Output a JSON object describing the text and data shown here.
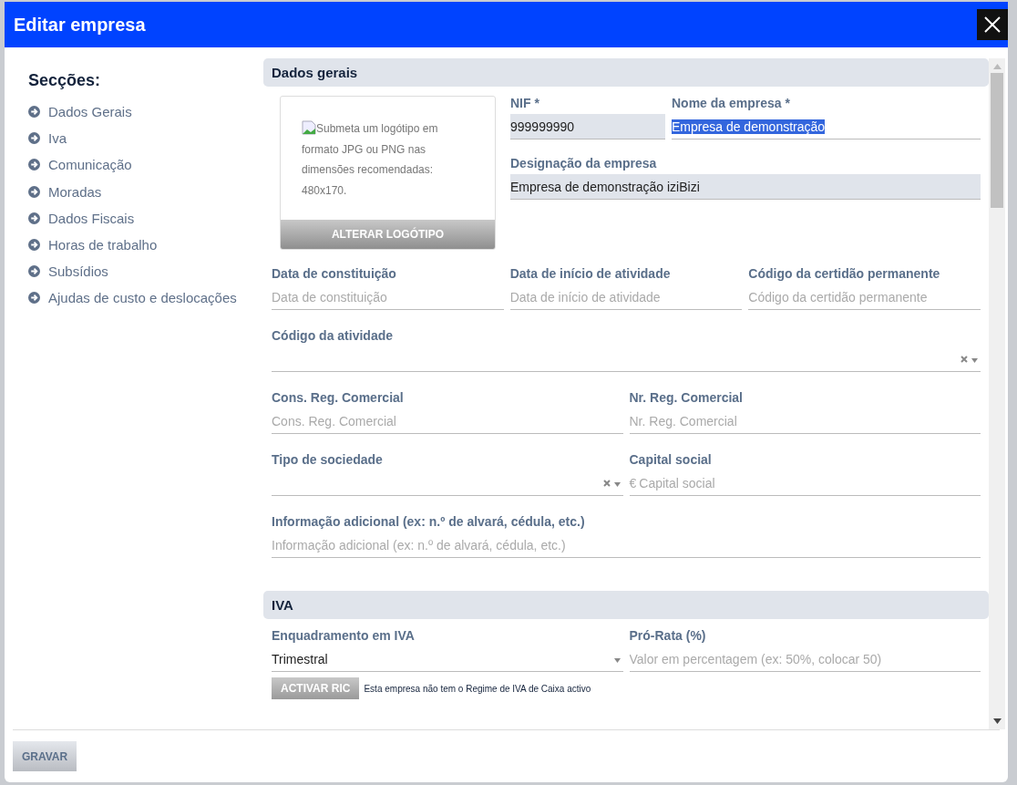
{
  "dialog": {
    "title": "Editar empresa"
  },
  "sidebar": {
    "heading": "Secções:",
    "items": [
      "Dados Gerais",
      "Iva",
      "Comunicação",
      "Moradas",
      "Dados Fiscais",
      "Horas de trabalho",
      "Subsídios",
      "Ajudas de custo e deslocações"
    ]
  },
  "general": {
    "title": "Dados gerais",
    "logo": {
      "text": "Submeta um logótipo em formato JPG ou PNG nas dimensões recomendadas: 480x170.",
      "button": "ALTERAR LOGÓTIPO"
    },
    "identity_rows": [
      [
        {
          "kind": "text",
          "label": "NIF *",
          "value": "999999990",
          "readonly": true,
          "text_selected": false
        },
        {
          "kind": "text",
          "label": "Nome da empresa *",
          "value": "Empresa de demonstração",
          "readonly": false,
          "text_selected": true
        }
      ],
      [
        {
          "kind": "text",
          "label": "Designação da empresa",
          "value": "Empresa de demonstração iziBizi",
          "readonly": true,
          "text_selected": false
        }
      ]
    ],
    "rows": [
      [
        {
          "kind": "text",
          "label": "Data de constituição",
          "placeholder": "Data de constituição"
        },
        {
          "kind": "text",
          "label": "Data de início de atividade",
          "placeholder": "Data de início de atividade"
        },
        {
          "kind": "text",
          "label": "Código da certidão permanente",
          "placeholder": "Código da certidão permanente"
        }
      ],
      [
        {
          "kind": "select",
          "label": "Código da atividade",
          "clearable": true
        }
      ],
      [
        {
          "kind": "text",
          "label": "Cons. Reg. Comercial",
          "placeholder": "Cons. Reg. Comercial"
        },
        {
          "kind": "text",
          "label": "Nr. Reg. Comercial",
          "placeholder": "Nr. Reg. Comercial"
        }
      ],
      [
        {
          "kind": "select",
          "label": "Tipo de sociedade",
          "clearable": true
        },
        {
          "kind": "money",
          "label": "Capital social",
          "prefix": "€",
          "placeholder": "Capital social"
        }
      ],
      [
        {
          "kind": "text",
          "label": "Informação adicional (ex: n.º de alvará, cédula, etc.)",
          "placeholder": "Informação adicional (ex: n.º de alvará, cédula, etc.)"
        }
      ]
    ]
  },
  "iva": {
    "title": "IVA",
    "rows": [
      [
        {
          "kind": "select",
          "label": "Enquadramento em IVA",
          "value": "Trimestral",
          "clearable": false
        },
        {
          "kind": "text",
          "label": "Pró-Rata (%)",
          "placeholder": "Valor em percentagem (ex: 50%, colocar 50)"
        }
      ]
    ],
    "ric_button": "ACTIVAR RIC",
    "ric_note": "Esta empresa não tem o Regime de IVA de Caixa activo"
  },
  "footer": {
    "save": "GRAVAR"
  }
}
